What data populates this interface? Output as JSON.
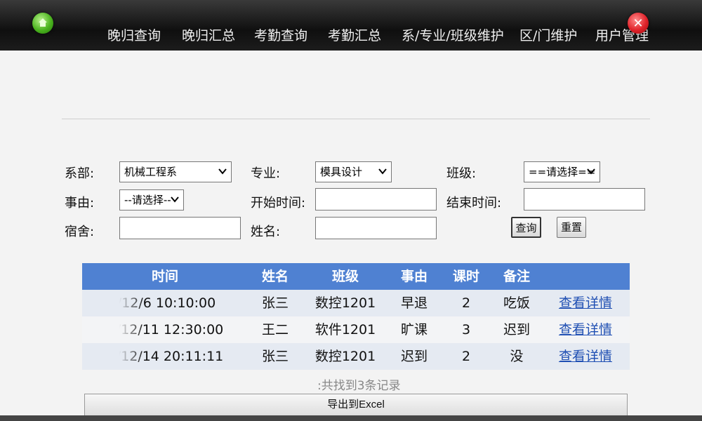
{
  "nav": {
    "items": [
      "晚归查询",
      "晚归汇总",
      "考勤查询",
      "考勤汇总",
      "系/专业/班级维护",
      "区/门维护",
      "用户管理"
    ]
  },
  "filters": {
    "department_label": "系部:",
    "department_value": "机械工程系",
    "major_label": "专业:",
    "major_value": "模具设计",
    "class_label": "班级:",
    "class_value": "==请选择==",
    "reason_label": "事由:",
    "reason_value": "--请选择--",
    "start_time_label": "开始时间:",
    "start_time_value": "",
    "end_time_label": "结束时间:",
    "end_time_value": "",
    "dorm_label": "宿舍:",
    "dorm_value": "",
    "name_label": "姓名:",
    "name_value": "",
    "query_button": "查询",
    "reset_button": "重置"
  },
  "table": {
    "headers": [
      "时间",
      "姓名",
      "班级",
      "事由",
      "课时",
      "备注"
    ],
    "rows": [
      {
        "time": "/12/6 10:10:00",
        "name": "张三",
        "class": "数控1201",
        "reason": "早退",
        "hours": "2",
        "note": "吃饭",
        "action": "查看详情"
      },
      {
        "time": "/12/11 12:30:00",
        "name": "王二",
        "class": "软件1201",
        "reason": "旷课",
        "hours": "3",
        "note": "迟到",
        "action": "查看详情"
      },
      {
        "time": "/12/14 20:11:11",
        "name": "张三",
        "class": "数控1201",
        "reason": "迟到",
        "hours": "2",
        "note": "没",
        "action": "查看详情"
      }
    ]
  },
  "summary": ":共找到3条记录",
  "export_button": "导出到Excel",
  "colors": {
    "header_bg": "#4f81d2",
    "row_alt_bg": "#e5eaf2",
    "link": "#1f4fb3",
    "topbar": "#1a1a1a"
  },
  "icons": {
    "home": "home-icon",
    "close": "close-icon",
    "dropdown": "chevron-down-icon"
  }
}
